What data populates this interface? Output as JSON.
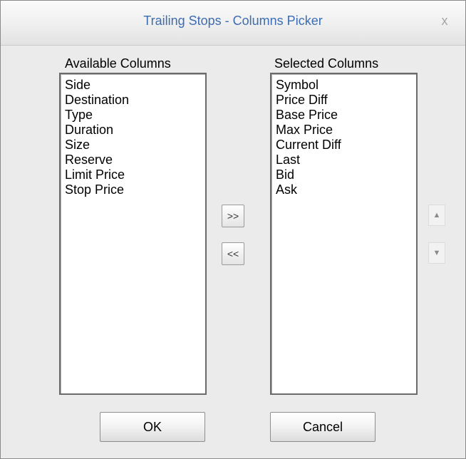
{
  "window": {
    "title": "Trailing Stops - Columns Picker",
    "close_glyph": "x"
  },
  "available": {
    "label": "Available Columns",
    "items": [
      "Side",
      "Destination",
      "Type",
      "Duration",
      "Size",
      "Reserve",
      "Limit Price",
      "Stop Price"
    ]
  },
  "selected": {
    "label": "Selected Columns",
    "items": [
      "Symbol",
      "Price Diff",
      "Base Price",
      "Max Price",
      "Current Diff",
      "Last",
      "Bid",
      "Ask"
    ]
  },
  "transfer": {
    "add_label": ">>",
    "remove_label": "<<"
  },
  "order": {
    "up_glyph": "▲",
    "down_glyph": "▼"
  },
  "buttons": {
    "ok_label": "OK",
    "cancel_label": "Cancel"
  }
}
